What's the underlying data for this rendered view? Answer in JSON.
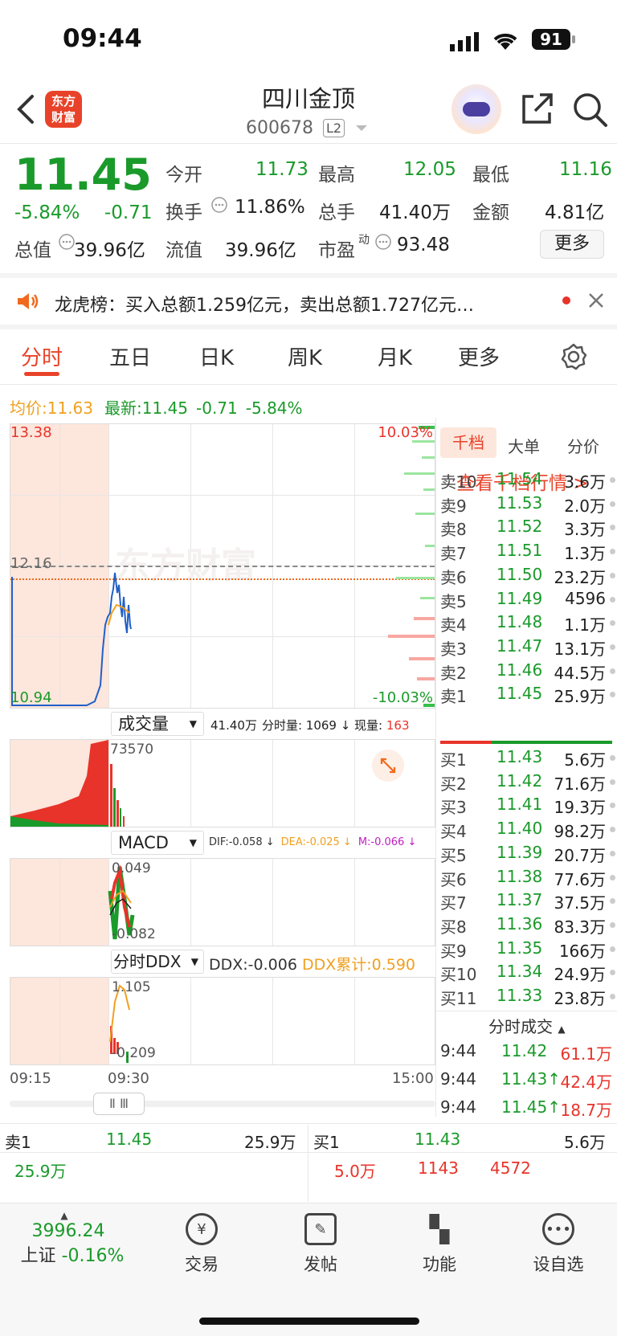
{
  "status": {
    "time": "09:44",
    "battery": "91"
  },
  "header": {
    "title": "四川金顶",
    "code": "600678",
    "level": "L2",
    "logo_text": "东方财富"
  },
  "quote": {
    "price": "11.45",
    "change_pct": "-5.84%",
    "change": "-0.71",
    "open_label": "今开",
    "open": "11.73",
    "high_label": "最高",
    "high": "12.05",
    "low_label": "最低",
    "low": "11.16",
    "turnover_label": "换手",
    "turnover": "11.86%",
    "volume_label": "总手",
    "volume": "41.40万",
    "amount_label": "金额",
    "amount": "4.81亿",
    "mktcap_label": "总值",
    "mktcap": "39.96亿",
    "float_label": "流值",
    "float": "39.96亿",
    "pe_label": "市盈",
    "pe_sup": "动",
    "pe": "93.48",
    "more": "更多"
  },
  "notice": {
    "text": "龙虎榜：买入总额1.259亿元，卖出总额1.727亿元…"
  },
  "tabs": [
    "分时",
    "五日",
    "日K",
    "周K",
    "月K",
    "更多"
  ],
  "legend": {
    "avg_label": "均价:",
    "avg": "11.63",
    "latest_label": "最新:",
    "latest": "11.45",
    "chg": "-0.71",
    "pct": "-5.84%"
  },
  "chart": {
    "y_top": "13.38",
    "y_mid": "12.16",
    "y_bot": "10.94",
    "pct_top": "10.03%",
    "pct_bot": "-10.03%",
    "watermark": "东方财富",
    "time_start": "09:15",
    "time_mid": "09:30",
    "time_end": "15:00"
  },
  "volume_panel": {
    "label": "成交量",
    "total": "41.40万",
    "info": "分时量: 1069 ↓ 现量:",
    "now": "163",
    "max": "73570"
  },
  "macd_panel": {
    "label": "MACD",
    "dif": "DIF:-0.058 ↓",
    "dea": "DEA:-0.025 ↓",
    "m": "M:-0.066 ↓",
    "top": "0.049",
    "bot": "-0.082"
  },
  "ddx_panel": {
    "label": "分时DDX",
    "ddx": "DDX:-0.006",
    "cum": "DDX累计:0.590",
    "top": "1.105",
    "bot": "-0.209"
  },
  "orderbook": {
    "tabs": [
      "千档",
      "大单",
      "分价"
    ],
    "link": "查看千档行情 >",
    "sells": [
      {
        "label": "卖10",
        "price": "11.54",
        "vol": "3.6万"
      },
      {
        "label": "卖9",
        "price": "11.53",
        "vol": "2.0万"
      },
      {
        "label": "卖8",
        "price": "11.52",
        "vol": "3.3万"
      },
      {
        "label": "卖7",
        "price": "11.51",
        "vol": "1.3万"
      },
      {
        "label": "卖6",
        "price": "11.50",
        "vol": "23.2万"
      },
      {
        "label": "卖5",
        "price": "11.49",
        "vol": "4596"
      },
      {
        "label": "卖4",
        "price": "11.48",
        "vol": "1.1万"
      },
      {
        "label": "卖3",
        "price": "11.47",
        "vol": "13.1万"
      },
      {
        "label": "卖2",
        "price": "11.46",
        "vol": "44.5万"
      },
      {
        "label": "卖1",
        "price": "11.45",
        "vol": "25.9万"
      }
    ],
    "buys": [
      {
        "label": "买1",
        "price": "11.43",
        "vol": "5.6万"
      },
      {
        "label": "买2",
        "price": "11.42",
        "vol": "71.6万"
      },
      {
        "label": "买3",
        "price": "11.41",
        "vol": "19.3万"
      },
      {
        "label": "买4",
        "price": "11.40",
        "vol": "98.2万"
      },
      {
        "label": "买5",
        "price": "11.39",
        "vol": "20.7万"
      },
      {
        "label": "买6",
        "price": "11.38",
        "vol": "77.6万"
      },
      {
        "label": "买7",
        "price": "11.37",
        "vol": "37.5万"
      },
      {
        "label": "买8",
        "price": "11.36",
        "vol": "83.3万"
      },
      {
        "label": "买9",
        "price": "11.35",
        "vol": "166万"
      },
      {
        "label": "买10",
        "price": "11.34",
        "vol": "24.9万"
      },
      {
        "label": "买11",
        "price": "11.33",
        "vol": "23.8万"
      }
    ],
    "ticks_label": "分时成交",
    "ticks": [
      {
        "time": "9:44",
        "price": "11.42",
        "vol": "61.1万"
      },
      {
        "time": "9:44",
        "price": "11.43↑",
        "vol": "42.4万"
      },
      {
        "time": "9:44",
        "price": "11.45↑",
        "vol": "18.7万"
      }
    ]
  },
  "summary": {
    "sell1_label": "卖1",
    "sell1_price": "11.45",
    "sell1_vol": "25.9万",
    "buy1_label": "买1",
    "buy1_price": "11.43",
    "buy1_vol": "5.6万",
    "left_val": "25.9万",
    "r1": "5.0万",
    "r2": "1143",
    "r3": "4572"
  },
  "nav": {
    "index_value": "3996.24",
    "index_name": "上证",
    "index_pct": "-0.16%",
    "items": [
      "交易",
      "发帖",
      "功能",
      "设自选"
    ]
  }
}
